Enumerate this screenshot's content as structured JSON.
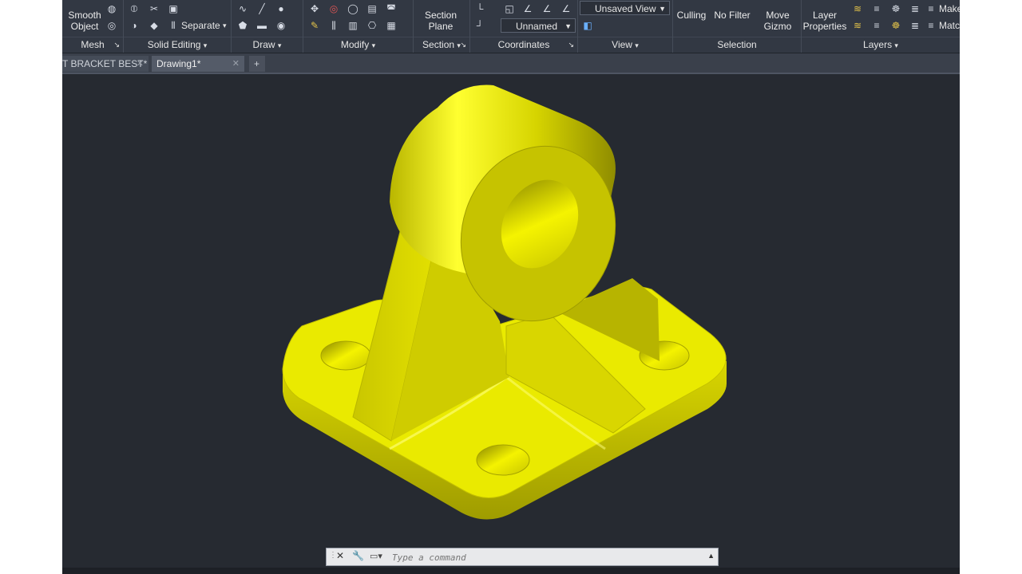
{
  "ribbon": {
    "mesh": {
      "title": "Mesh",
      "smooth_line1": "Smooth",
      "smooth_line2": "Object"
    },
    "solid_editing": {
      "title": "Solid Editing",
      "separate_label": "Separate"
    },
    "draw": {
      "title": "Draw"
    },
    "modify": {
      "title": "Modify"
    },
    "section": {
      "title": "Section",
      "plane_line1": "Section",
      "plane_line2": "Plane"
    },
    "coordinates": {
      "title": "Coordinates",
      "ucs_value": "Unnamed"
    },
    "view": {
      "title": "View",
      "view_value": "Unsaved View"
    },
    "selection": {
      "title": "Selection",
      "culling": "Culling",
      "no_filter": "No Filter",
      "move_gizmo_line1": "Move",
      "move_gizmo_line2": "Gizmo"
    },
    "layers": {
      "title": "Layers",
      "layer_properties_line1": "Layer",
      "layer_properties_line2": "Properties",
      "make": "Make",
      "match": "Matc"
    }
  },
  "tabs": [
    {
      "label": "T BRACKET BEST*",
      "active": false
    },
    {
      "label": "Drawing1*",
      "active": true
    }
  ],
  "new_tab_symbol": "+",
  "command": {
    "placeholder": "Type a command"
  },
  "colors": {
    "ribbon_bg": "#323843",
    "viewport_bg": "#262a31",
    "model_yellow": "#e0e000"
  }
}
